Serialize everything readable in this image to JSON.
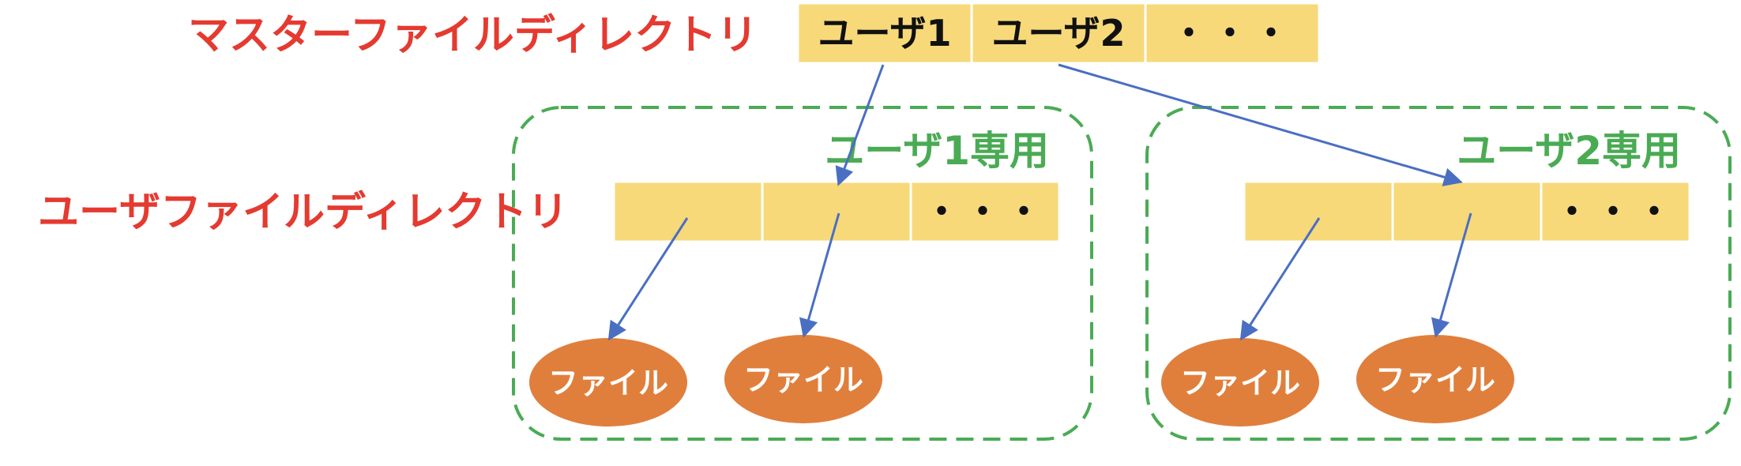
{
  "labels": {
    "master_directory": "マスターファイルディレクトリ",
    "user_directory": "ユーザファイルディレクトリ",
    "user1_only": "ユーザ1専用",
    "user2_only": "ユーザ2専用"
  },
  "master_cells": [
    "ユーザ1",
    "ユーザ2",
    "・・・"
  ],
  "user1_cells": [
    "",
    "",
    "・・・"
  ],
  "user2_cells": [
    "",
    "",
    "・・・"
  ],
  "files": {
    "u1_file1": "ファイル",
    "u1_file2": "ファイル",
    "u2_file1": "ファイル",
    "u2_file2": "ファイル"
  },
  "colors": {
    "label_red": "#e53a30",
    "group_green": "#4aab54",
    "cell_yellow": "#f7d97a",
    "file_orange": "#e07f3c",
    "arrow_blue": "#4a6fc2"
  }
}
